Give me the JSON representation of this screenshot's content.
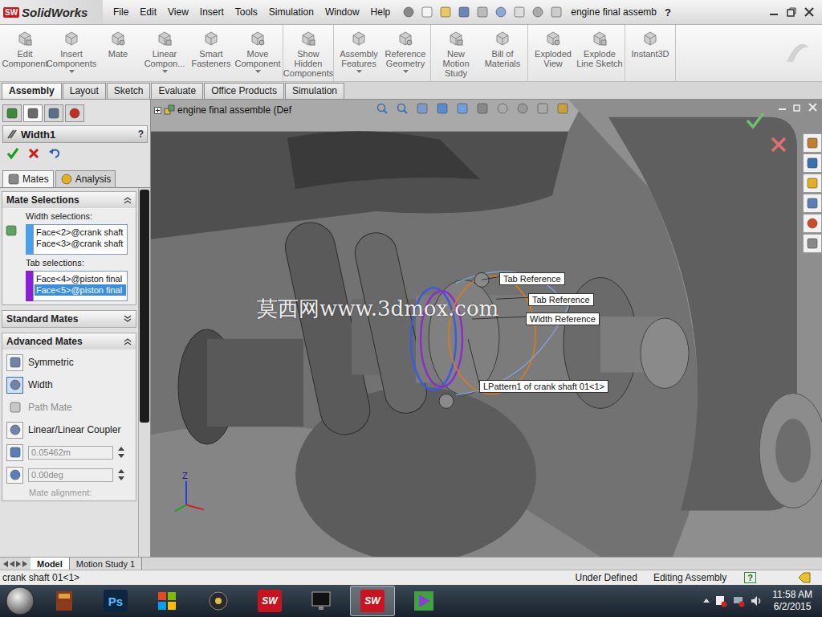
{
  "titlebar": {
    "logo_badge": "SW",
    "logo_text": "SolidWorks",
    "menus": [
      "File",
      "Edit",
      "View",
      "Insert",
      "Tools",
      "Simulation",
      "Window",
      "Help"
    ],
    "document": "engine final assemb",
    "help": "?"
  },
  "command_groups": [
    [
      {
        "label": "Edit Component",
        "dropdown": false
      },
      {
        "label": "Insert Components",
        "dropdown": true
      },
      {
        "label": "Mate",
        "dropdown": false
      },
      {
        "label": "Linear Compon...",
        "dropdown": true
      },
      {
        "label": "Smart Fasteners",
        "dropdown": false
      },
      {
        "label": "Move Component",
        "dropdown": true
      }
    ],
    [
      {
        "label": "Show Hidden Components",
        "dropdown": false
      }
    ],
    [
      {
        "label": "Assembly Features",
        "dropdown": true
      },
      {
        "label": "Reference Geometry",
        "dropdown": true
      }
    ],
    [
      {
        "label": "New Motion Study",
        "dropdown": false
      },
      {
        "label": "Bill of Materials",
        "dropdown": false
      }
    ],
    [
      {
        "label": "Exploded View",
        "dropdown": false
      },
      {
        "label": "Explode Line Sketch",
        "dropdown": false
      }
    ],
    [
      {
        "label": "Instant3D",
        "dropdown": false
      }
    ]
  ],
  "ribbon_tabs": [
    {
      "label": "Assembly",
      "selected": true
    },
    {
      "label": "Layout",
      "selected": false
    },
    {
      "label": "Sketch",
      "selected": false
    },
    {
      "label": "Evaluate",
      "selected": false
    },
    {
      "label": "Office Products",
      "selected": false
    },
    {
      "label": "Simulation",
      "selected": false
    }
  ],
  "property_manager": {
    "title": "Width1",
    "help": "?",
    "feature_tabs": [
      {
        "label": "Mates",
        "selected": true
      },
      {
        "label": "Analysis",
        "selected": false
      }
    ],
    "mate_selections": {
      "title": "Mate Selections",
      "expanded": true,
      "groups": [
        {
          "label": "Width selections:",
          "color": "#4a9fe6",
          "items": [
            {
              "label": "Face<2>@crank shaft",
              "selected": false
            },
            {
              "label": "Face<3>@crank shaft",
              "selected": false
            }
          ]
        },
        {
          "label": "Tab selections:",
          "color": "#8a1fd6",
          "items": [
            {
              "label": "Face<4>@piston final",
              "selected": false
            },
            {
              "label": "Face<5>@piston final",
              "selected": true
            }
          ]
        }
      ]
    },
    "standard_mates": {
      "title": "Standard Mates",
      "expanded": false
    },
    "advanced_mates": {
      "title": "Advanced Mates",
      "expanded": true,
      "items": [
        {
          "label": "Symmetric",
          "selected": false,
          "disabled": false
        },
        {
          "label": "Width",
          "selected": true,
          "disabled": false
        },
        {
          "label": "Path Mate",
          "selected": false,
          "disabled": true
        },
        {
          "label": "Linear/Linear Coupler",
          "selected": false,
          "disabled": false
        }
      ],
      "fields": [
        {
          "kind": "distance",
          "value": "0.05462m",
          "disabled": true
        },
        {
          "kind": "angle",
          "value": "0.00deg",
          "disabled": true
        }
      ],
      "alignment_label": "Mate alignment:",
      "alignment_disabled": true
    }
  },
  "viewport": {
    "tree_label": "engine final assemble (Def",
    "watermark": "莫西网www.3dmox.com",
    "triad_label": "Z",
    "callouts": [
      {
        "label": "Tab Reference"
      },
      {
        "label": "Tab Reference"
      },
      {
        "label": "Width Reference"
      },
      {
        "label": "LPattern1 of crank shaft 01<1>"
      }
    ]
  },
  "bottom_tabs": [
    {
      "label": "Model",
      "selected": true
    },
    {
      "label": "Motion Study 1",
      "selected": false
    }
  ],
  "status_bar": {
    "selection": "crank shaft 01<1>",
    "state": "Under Defined",
    "mode": "Editing Assembly",
    "help": "?"
  },
  "taskbar": {
    "apps": [
      {
        "kind": "book",
        "label": "",
        "selected": false
      },
      {
        "kind": "ps",
        "label": "Ps",
        "selected": false
      },
      {
        "kind": "office",
        "label": "",
        "selected": false
      },
      {
        "kind": "media",
        "label": "",
        "selected": false
      },
      {
        "kind": "sw",
        "label": "SW",
        "selected": false
      },
      {
        "kind": "monitor",
        "label": "",
        "selected": false
      },
      {
        "kind": "sw",
        "label": "SW",
        "selected": true
      },
      {
        "kind": "video",
        "label": "",
        "selected": false
      }
    ],
    "time": "11:58 AM",
    "date": "6/2/2015"
  }
}
